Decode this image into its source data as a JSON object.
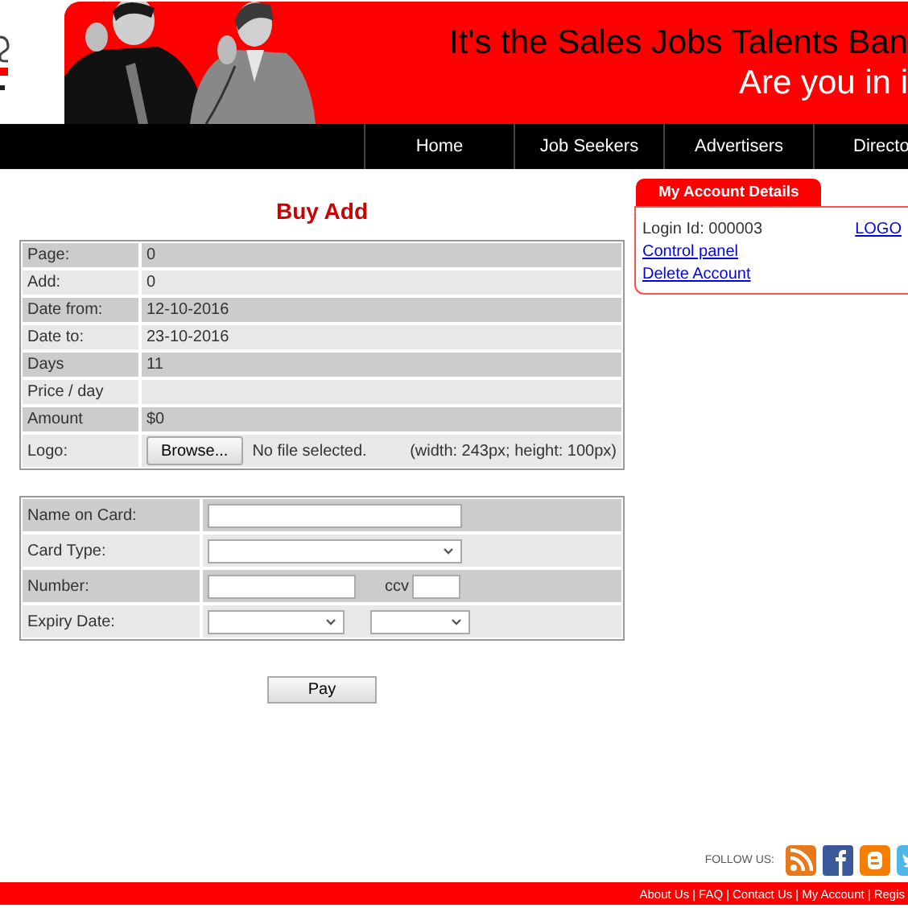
{
  "banner": {
    "headline": "It's the Sales Jobs Talents Ban",
    "tagline": "Are you in i"
  },
  "nav": [
    {
      "label": "Home"
    },
    {
      "label": "Job Seekers"
    },
    {
      "label": "Advertisers"
    },
    {
      "label": "Directo"
    }
  ],
  "title": "Buy Add",
  "details": [
    {
      "kind": "text",
      "label": "Page:",
      "value": "0"
    },
    {
      "kind": "text",
      "label": "Add:",
      "value": "0"
    },
    {
      "kind": "text",
      "label": "Date from:",
      "value": "12-10-2016"
    },
    {
      "kind": "text",
      "label": "Date to:",
      "value": "23-10-2016"
    },
    {
      "kind": "text",
      "label": "Days",
      "value": "11"
    },
    {
      "kind": "text",
      "label": "Price / day"
    },
    {
      "kind": "text",
      "label": "Amount",
      "value": "$0"
    },
    {
      "kind": "file",
      "label": "Logo:",
      "button": "Browse...",
      "status": "No file selected.",
      "hint": "(width: 243px; height: 100px)"
    }
  ],
  "payment": [
    {
      "kind": "input",
      "label": "Name on Card:"
    },
    {
      "kind": "select",
      "label": "Card Type:"
    },
    {
      "kind": "number",
      "label": "Number:",
      "extra_label": "ccv"
    },
    {
      "kind": "expiry",
      "label": "Expiry Date:"
    }
  ],
  "pay_button": "Pay",
  "account": {
    "title": "My Account Details",
    "login_id": "Login Id: 000003",
    "logout": "LOGO",
    "links": [
      "Control panel",
      "Delete Account"
    ]
  },
  "follow": {
    "label": "FOLLOW US:",
    "icons": [
      {
        "kind": "rss"
      },
      {
        "kind": "facebook"
      },
      {
        "kind": "blogger"
      },
      {
        "kind": "twitter"
      }
    ]
  },
  "footer_links": [
    "About Us",
    "FAQ",
    "Contact Us",
    "My Account",
    "Regis"
  ],
  "footer_separator": "|"
}
